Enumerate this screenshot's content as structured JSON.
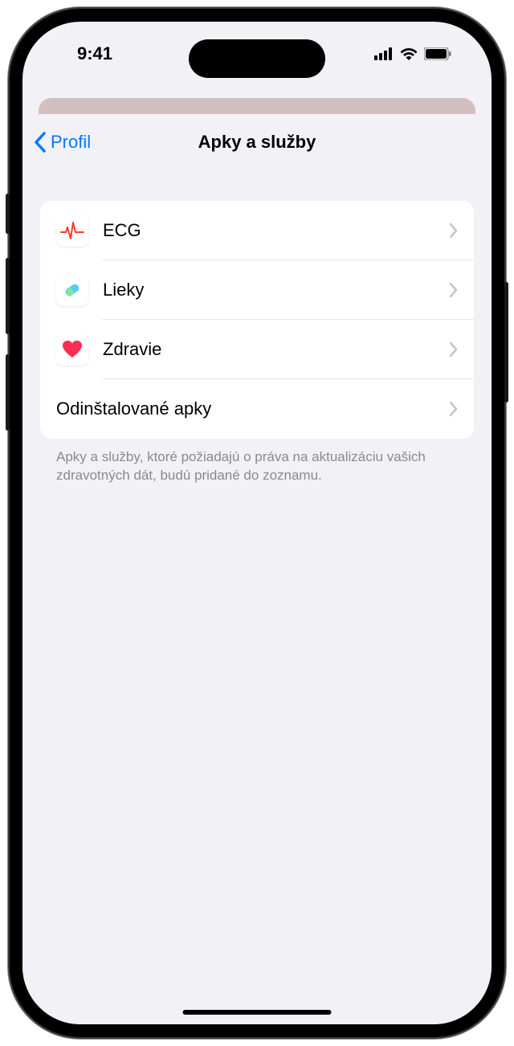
{
  "status": {
    "time": "9:41"
  },
  "nav": {
    "back_label": "Profil",
    "title": "Apky a služby"
  },
  "list": {
    "items": [
      {
        "label": "ECG",
        "icon": "ecg"
      },
      {
        "label": "Lieky",
        "icon": "pill"
      },
      {
        "label": "Zdravie",
        "icon": "heart"
      }
    ],
    "uninstalled_label": "Odinštalované apky"
  },
  "footer": {
    "text": "Apky a služby, ktoré požiadajú o práva na aktualizáciu vašich zdravotných dát, budú pridané do zoznamu."
  }
}
